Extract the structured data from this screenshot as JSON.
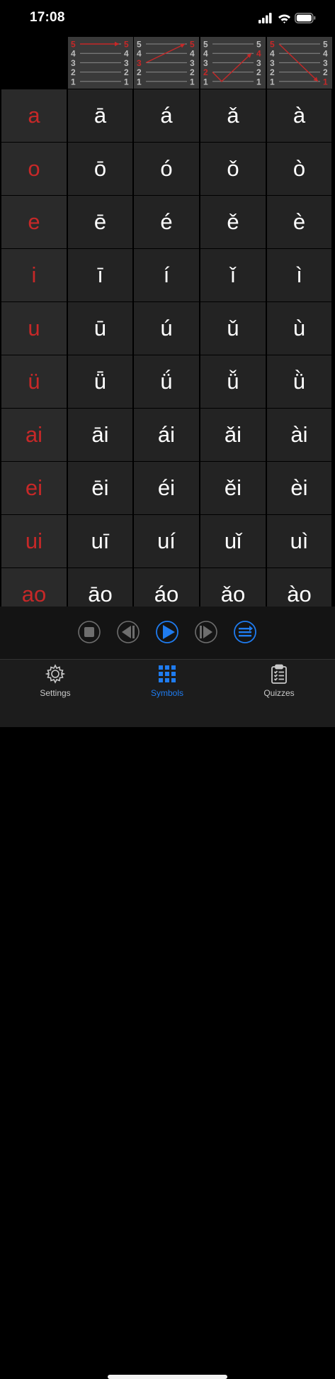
{
  "status_bar": {
    "time": "17:08"
  },
  "tone_headers": [
    {
      "name": "tone-1",
      "highlight": [
        5,
        5
      ],
      "ticks": [
        "5",
        "4",
        "3",
        "2",
        "1"
      ]
    },
    {
      "name": "tone-2",
      "highlight": [
        3,
        5
      ],
      "ticks": [
        "5",
        "4",
        "3",
        "2",
        "1"
      ]
    },
    {
      "name": "tone-3",
      "highlight": [
        2,
        4
      ],
      "ticks": [
        "5",
        "4",
        "3",
        "2",
        "1"
      ]
    },
    {
      "name": "tone-4",
      "highlight": [
        5,
        1
      ],
      "ticks": [
        "5",
        "4",
        "3",
        "2",
        "1"
      ]
    }
  ],
  "rows": [
    {
      "label": "a",
      "tones": [
        "ā",
        "á",
        "ǎ",
        "à"
      ]
    },
    {
      "label": "o",
      "tones": [
        "ō",
        "ó",
        "ǒ",
        "ò"
      ]
    },
    {
      "label": "e",
      "tones": [
        "ē",
        "é",
        "ě",
        "è"
      ]
    },
    {
      "label": "i",
      "tones": [
        "ī",
        "í",
        "ǐ",
        "ì"
      ]
    },
    {
      "label": "u",
      "tones": [
        "ū",
        "ú",
        "ǔ",
        "ù"
      ]
    },
    {
      "label": "ü",
      "tones": [
        "ǖ",
        "ǘ",
        "ǚ",
        "ǜ"
      ]
    },
    {
      "label": "ai",
      "tones": [
        "āi",
        "ái",
        "ǎi",
        "ài"
      ]
    },
    {
      "label": "ei",
      "tones": [
        "ēi",
        "éi",
        "ěi",
        "èi"
      ]
    },
    {
      "label": "ui",
      "tones": [
        "uī",
        "uí",
        "uǐ",
        "uì"
      ]
    },
    {
      "label": "ao",
      "tones": [
        "āo",
        "áo",
        "ǎo",
        "ào"
      ]
    }
  ],
  "controls": {
    "buttons": [
      "stop-icon",
      "rewind-icon",
      "play-icon",
      "forward-icon",
      "list-icon"
    ],
    "active_color": "#1f7cf0",
    "inactive_color": "#6e6e6e"
  },
  "tab_bar": {
    "settings_label": "Settings",
    "symbols_label": "Symbols",
    "quizzes_label": "Quizzes",
    "active_tab": "Symbols"
  },
  "colors": {
    "accent_red": "#c62828",
    "accent_blue": "#1f7cf0"
  }
}
